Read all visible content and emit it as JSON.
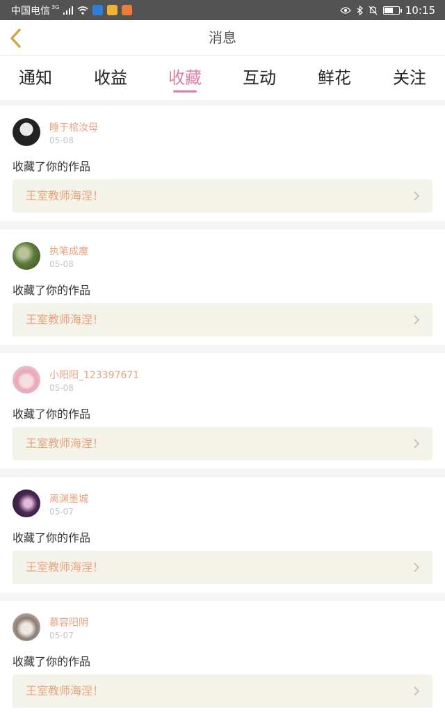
{
  "status_bar": {
    "carrier": "中国电信",
    "network": "3G",
    "time": "10:15",
    "battery_level": 0.55,
    "icons": [
      "signal-icon",
      "wifi-icon",
      "shield-app-icon",
      "app-icon",
      "app-icon",
      "eye-icon",
      "bluetooth-icon",
      "mute-bell-icon",
      "battery-icon"
    ]
  },
  "header": {
    "title": "消息",
    "back_icon": "chevron-left-icon"
  },
  "tabs": [
    {
      "label": "通知",
      "active": false
    },
    {
      "label": "收益",
      "active": false
    },
    {
      "label": "收藏",
      "active": true
    },
    {
      "label": "互动",
      "active": false
    },
    {
      "label": "鲜花",
      "active": false
    },
    {
      "label": "关注",
      "active": false
    }
  ],
  "items": [
    {
      "username": "睡于棺汝母",
      "date": "05-08",
      "action": "收藏了你的作品",
      "work": "王室教师海涅！"
    },
    {
      "username": "执笔成魔",
      "date": "05-08",
      "action": "收藏了你的作品",
      "work": "王室教师海涅！"
    },
    {
      "username": "小阳阳_123397671",
      "date": "05-08",
      "action": "收藏了你的作品",
      "work": "王室教师海涅！"
    },
    {
      "username": "离渊墨城",
      "date": "05-07",
      "action": "收藏了你的作品",
      "work": "王室教师海涅！"
    },
    {
      "username": "慕容阳阴",
      "date": "05-07",
      "action": "收藏了你的作品",
      "work": "王室教师海涅！"
    }
  ],
  "colors": {
    "accent": "#e07fa6",
    "username": "#e8a27c",
    "link_bg": "#f4f3ea",
    "back_arrow": "#c9a64a"
  }
}
